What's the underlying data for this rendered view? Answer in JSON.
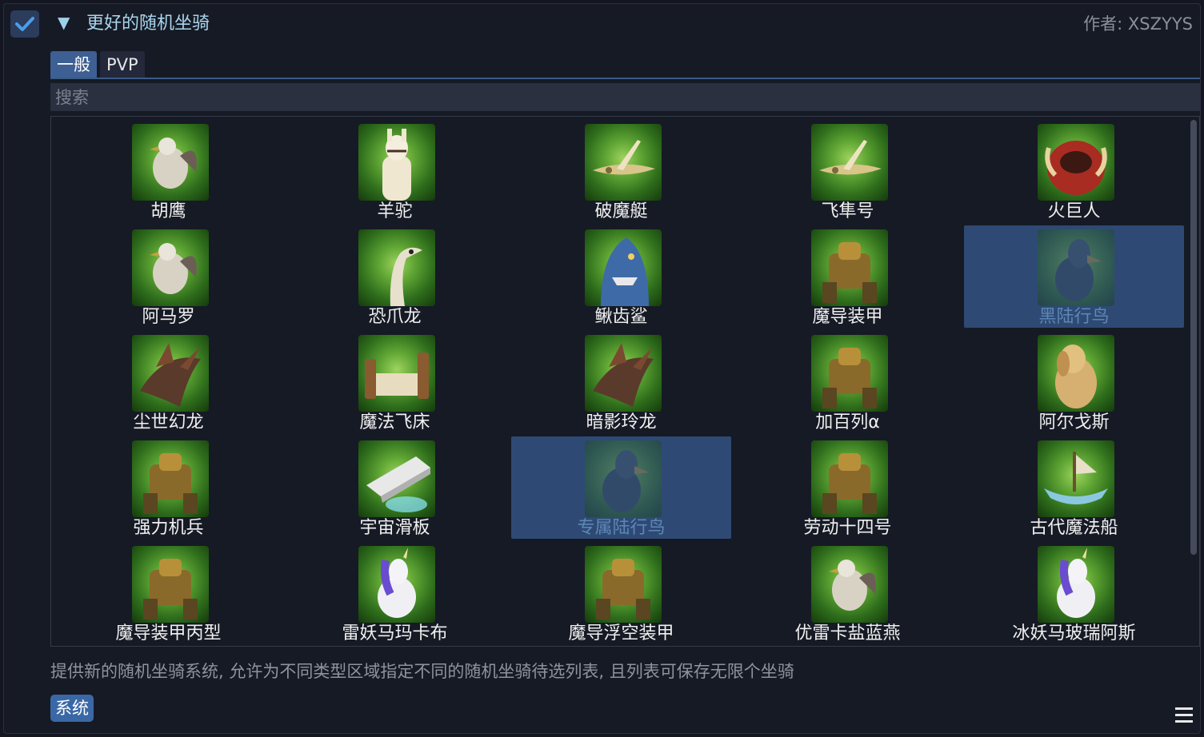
{
  "header": {
    "checked": true,
    "collapse_glyph": "▼",
    "title": "更好的随机坐骑",
    "author": "作者: XSZYYS"
  },
  "tabs": [
    {
      "label": "一般",
      "active": true
    },
    {
      "label": "PVP",
      "active": false
    }
  ],
  "search": {
    "placeholder": "搜索",
    "value": ""
  },
  "mounts": [
    {
      "name": "胡鹰",
      "icon": "bird-icon",
      "selected": false
    },
    {
      "name": "羊驼",
      "icon": "llama-icon",
      "selected": false
    },
    {
      "name": "破魔艇",
      "icon": "airship-icon",
      "selected": false
    },
    {
      "name": "飞隼号",
      "icon": "airship-icon",
      "selected": false
    },
    {
      "name": "火巨人",
      "icon": "beast-icon",
      "selected": false
    },
    {
      "name": "阿马罗",
      "icon": "bird-icon",
      "selected": false
    },
    {
      "name": "恐爪龙",
      "icon": "raptor-icon",
      "selected": false
    },
    {
      "name": "鳅齿鲨",
      "icon": "shark-icon",
      "selected": false
    },
    {
      "name": "魔导装甲",
      "icon": "mech-icon",
      "selected": false
    },
    {
      "name": "黑陆行鸟",
      "icon": "chocobo-icon",
      "selected": true
    },
    {
      "name": "尘世幻龙",
      "icon": "dragon-icon",
      "selected": false
    },
    {
      "name": "魔法飞床",
      "icon": "bed-icon",
      "selected": false
    },
    {
      "name": "暗影玲龙",
      "icon": "dragon-icon",
      "selected": false
    },
    {
      "name": "加百列α",
      "icon": "mech-icon",
      "selected": false
    },
    {
      "name": "阿尔戈斯",
      "icon": "dog-icon",
      "selected": false
    },
    {
      "name": "强力机兵",
      "icon": "mech-icon",
      "selected": false
    },
    {
      "name": "宇宙滑板",
      "icon": "board-icon",
      "selected": false
    },
    {
      "name": "专属陆行鸟",
      "icon": "chocobo-icon",
      "selected": true
    },
    {
      "name": "劳动十四号",
      "icon": "mech-icon",
      "selected": false
    },
    {
      "name": "古代魔法船",
      "icon": "ship-icon",
      "selected": false
    },
    {
      "name": "魔导装甲丙型",
      "icon": "mech-icon",
      "selected": false
    },
    {
      "name": "雷妖马玛卡布",
      "icon": "unicorn-icon",
      "selected": false
    },
    {
      "name": "魔导浮空装甲",
      "icon": "mech-icon",
      "selected": false
    },
    {
      "name": "优雷卡盐蓝燕",
      "icon": "bird-icon",
      "selected": false
    },
    {
      "name": "冰妖马玻瑞阿斯",
      "icon": "unicorn-icon",
      "selected": false
    }
  ],
  "description": "提供新的随机坐骑系统, 允许为不同类型区域指定不同的随机坐骑待选列表, 且列表可保存无限个坐骑",
  "tag": "系统",
  "colors": {
    "accent": "#3d5f93",
    "title": "#a9d6ee",
    "selection": "#2e4a74",
    "icon_bg": "#5ea433"
  }
}
